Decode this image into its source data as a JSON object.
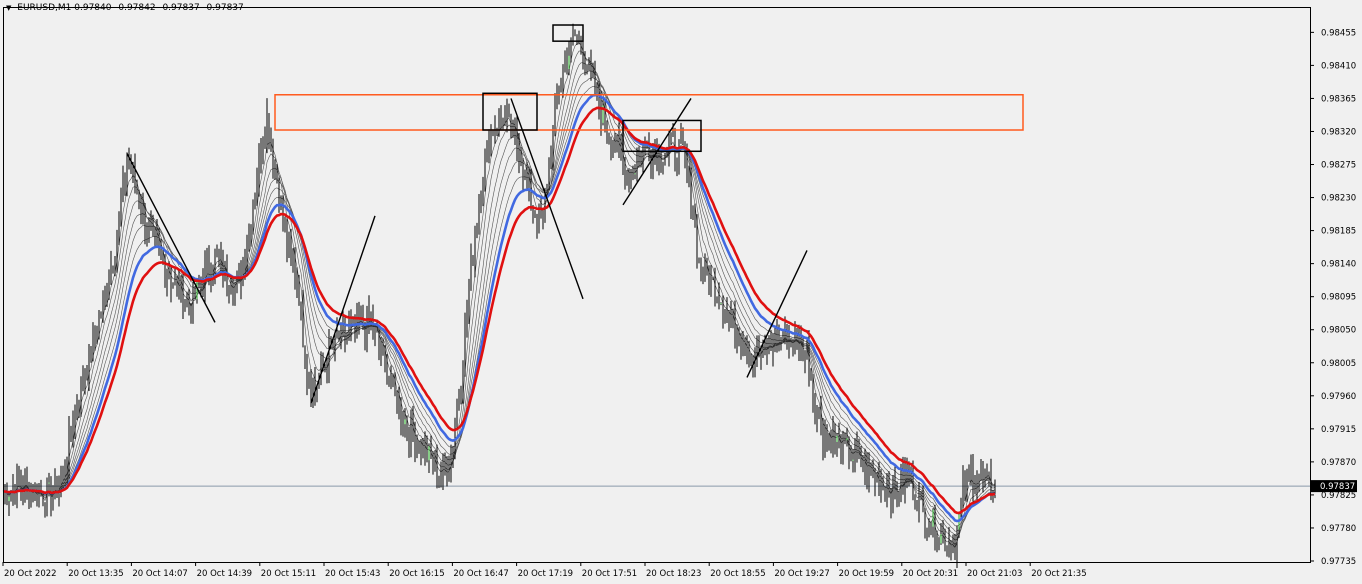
{
  "header": {
    "symbol": "EURUSD,M1",
    "open": "0.97840",
    "high": "0.97842",
    "low": "0.97837",
    "close": "0.97837"
  },
  "colors": {
    "background": "#f0f0f0",
    "candles": "#000000",
    "bull_accent": "#22aa22",
    "ma_fan": "#555555",
    "ma_fast": "#4169e1",
    "ma_slow": "#e01010",
    "zone": "#ff5a1e",
    "box": "#000000",
    "current_price_line": "#8a99aa",
    "price_tag": "#000000"
  },
  "chart_data": {
    "type": "candlestick",
    "symbol": "EURUSD",
    "timeframe": "M1",
    "grid": false,
    "y_axis": {
      "range": [
        0.97735,
        0.9848
      ],
      "ticks": [
        "0.98455",
        "0.98410",
        "0.98365",
        "0.98320",
        "0.98275",
        "0.98230",
        "0.98185",
        "0.98140",
        "0.98095",
        "0.98050",
        "0.98005",
        "0.97960",
        "0.97915",
        "0.97870",
        "0.97825",
        "0.97780",
        "0.97735"
      ]
    },
    "x_axis": {
      "range_minutes": [
        0,
        505
      ],
      "ticks": [
        {
          "label": "20 Oct 2022",
          "minute": 0
        },
        {
          "label": "20 Oct 13:35",
          "minute": 30
        },
        {
          "label": "20 Oct 14:07",
          "minute": 62
        },
        {
          "label": "20 Oct 14:39",
          "minute": 94
        },
        {
          "label": "20 Oct 15:11",
          "minute": 126
        },
        {
          "label": "20 Oct 15:43",
          "minute": 158
        },
        {
          "label": "20 Oct 16:15",
          "minute": 190
        },
        {
          "label": "20 Oct 16:47",
          "minute": 222
        },
        {
          "label": "20 Oct 17:19",
          "minute": 254
        },
        {
          "label": "20 Oct 17:51",
          "minute": 286
        },
        {
          "label": "20 Oct 18:23",
          "minute": 318
        },
        {
          "label": "20 Oct 18:55",
          "minute": 350
        },
        {
          "label": "20 Oct 19:27",
          "minute": 382
        },
        {
          "label": "20 Oct 19:59",
          "minute": 414
        },
        {
          "label": "20 Oct 20:31",
          "minute": 446
        },
        {
          "label": "20 Oct 21:03",
          "minute": 478
        },
        {
          "label": "20 Oct 21:35",
          "minute": 510
        }
      ]
    },
    "current_price": "0.97837",
    "price_path": [
      [
        0,
        0.9783
      ],
      [
        8,
        0.97838
      ],
      [
        16,
        0.9783
      ],
      [
        24,
        0.97822
      ],
      [
        30,
        0.9785
      ],
      [
        36,
        0.97945
      ],
      [
        44,
        0.9802
      ],
      [
        52,
        0.9811
      ],
      [
        57,
        0.9818
      ],
      [
        62,
        0.9828
      ],
      [
        66,
        0.9825
      ],
      [
        72,
        0.9819
      ],
      [
        78,
        0.9815
      ],
      [
        86,
        0.9811
      ],
      [
        94,
        0.9808
      ],
      [
        100,
        0.9812
      ],
      [
        106,
        0.9815
      ],
      [
        112,
        0.9812
      ],
      [
        118,
        0.9811
      ],
      [
        124,
        0.982
      ],
      [
        128,
        0.9828
      ],
      [
        132,
        0.9834
      ],
      [
        134,
        0.9831
      ],
      [
        138,
        0.9824
      ],
      [
        142,
        0.9817
      ],
      [
        148,
        0.981
      ],
      [
        152,
        0.9799
      ],
      [
        156,
        0.9797
      ],
      [
        160,
        0.98
      ],
      [
        168,
        0.9804
      ],
      [
        176,
        0.9805
      ],
      [
        184,
        0.9806
      ],
      [
        190,
        0.9801
      ],
      [
        196,
        0.9796
      ],
      [
        202,
        0.9792
      ],
      [
        210,
        0.9789
      ],
      [
        216,
        0.9786
      ],
      [
        220,
        0.9785
      ],
      [
        224,
        0.9788
      ],
      [
        228,
        0.9796
      ],
      [
        232,
        0.9808
      ],
      [
        236,
        0.9818
      ],
      [
        240,
        0.9826
      ],
      [
        244,
        0.9832
      ],
      [
        250,
        0.9834
      ],
      [
        254,
        0.9832
      ],
      [
        258,
        0.983
      ],
      [
        262,
        0.9824
      ],
      [
        266,
        0.9821
      ],
      [
        270,
        0.982
      ],
      [
        274,
        0.983
      ],
      [
        278,
        0.9838
      ],
      [
        282,
        0.9842
      ],
      [
        286,
        0.9845
      ],
      [
        290,
        0.9843
      ],
      [
        294,
        0.9839
      ],
      [
        300,
        0.9834
      ],
      [
        306,
        0.983
      ],
      [
        312,
        0.9826
      ],
      [
        318,
        0.9828
      ],
      [
        322,
        0.983
      ],
      [
        328,
        0.9829
      ],
      [
        334,
        0.983
      ],
      [
        340,
        0.9829
      ],
      [
        344,
        0.9823
      ],
      [
        348,
        0.9814
      ],
      [
        352,
        0.9812
      ],
      [
        358,
        0.981
      ],
      [
        364,
        0.9806
      ],
      [
        370,
        0.9804
      ],
      [
        376,
        0.9801
      ],
      [
        384,
        0.9803
      ],
      [
        392,
        0.9804
      ],
      [
        398,
        0.9803
      ],
      [
        402,
        0.9802
      ],
      [
        406,
        0.9795
      ],
      [
        410,
        0.9791
      ],
      [
        416,
        0.979
      ],
      [
        424,
        0.9788
      ],
      [
        432,
        0.9786
      ],
      [
        440,
        0.9784
      ],
      [
        446,
        0.9783
      ],
      [
        452,
        0.9785
      ],
      [
        456,
        0.9783
      ],
      [
        460,
        0.978
      ],
      [
        464,
        0.9779
      ],
      [
        468,
        0.9777
      ],
      [
        472,
        0.97765
      ],
      [
        476,
        0.9776
      ],
      [
        478,
        0.9779
      ],
      [
        480,
        0.9783
      ],
      [
        484,
        0.97855
      ],
      [
        488,
        0.97845
      ],
      [
        492,
        0.97838
      ],
      [
        496,
        0.97837
      ]
    ],
    "moving_averages": [
      {
        "role": "fan",
        "period": 5
      },
      {
        "role": "fan",
        "period": 8
      },
      {
        "role": "fan",
        "period": 12
      },
      {
        "role": "fan",
        "period": 16
      },
      {
        "role": "fan",
        "period": 20
      },
      {
        "role": "fan",
        "period": 25
      },
      {
        "role": "fast",
        "period": 30
      },
      {
        "role": "slow",
        "period": 38
      }
    ],
    "annotations": {
      "zone": {
        "t": [
          136,
          510
        ],
        "price": [
          0.98322,
          0.9837
        ]
      },
      "boxes": [
        {
          "t": [
            240,
            267
          ],
          "price": [
            0.98322,
            0.98372
          ]
        },
        {
          "t": [
            275,
            290
          ],
          "price": [
            0.98443,
            0.98465
          ]
        },
        {
          "t": [
            310,
            349
          ],
          "price": [
            0.98293,
            0.98335
          ]
        }
      ],
      "trendlines": [
        {
          "from": [
            62,
            0.9829
          ],
          "to": [
            106,
            0.9806
          ]
        },
        {
          "from": [
            154,
            0.9795
          ],
          "to": [
            186,
            0.98205
          ]
        },
        {
          "from": [
            254,
            0.98365
          ],
          "to": [
            290,
            0.98092
          ]
        },
        {
          "from": [
            310,
            0.9822
          ],
          "to": [
            344,
            0.98365
          ]
        },
        {
          "from": [
            372,
            0.97985
          ],
          "to": [
            402,
            0.98158
          ]
        }
      ]
    }
  }
}
